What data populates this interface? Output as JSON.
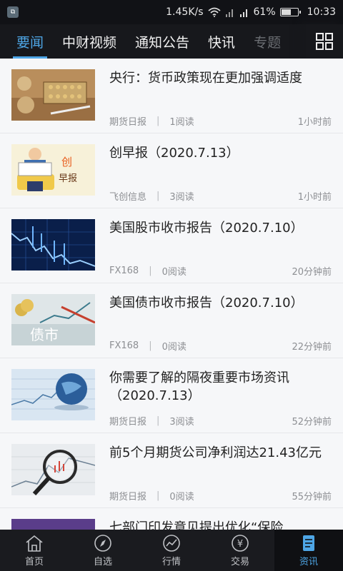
{
  "status_bar": {
    "app_icon_glyph": "⧉",
    "speed": "1.45K/s",
    "battery_pct": "61%",
    "battery_level": 0.61,
    "time": "10:33"
  },
  "tabs": [
    {
      "label": "要闻",
      "active": true
    },
    {
      "label": "中财视频"
    },
    {
      "label": "通知公告"
    },
    {
      "label": "快讯"
    },
    {
      "label": "专题"
    }
  ],
  "news": [
    {
      "title": "央行：货币政策现在更加强调适度",
      "source": "期货日报",
      "reads": "1阅读",
      "time": "1小时前"
    },
    {
      "title": "创早报（2020.7.13）",
      "source": "飞创信息",
      "reads": "3阅读",
      "time": "1小时前"
    },
    {
      "title": "美国股市收市报告（2020.7.10）",
      "source": "FX168",
      "reads": "0阅读",
      "time": "20分钟前"
    },
    {
      "title": "美国债市收市报告（2020.7.10）",
      "source": "FX168",
      "reads": "0阅读",
      "time": "22分钟前"
    },
    {
      "title": "你需要了解的隔夜重要市场资讯（2020.7.13）",
      "source": "期货日报",
      "reads": "3阅读",
      "time": "52分钟前"
    },
    {
      "title": "前5个月期货公司净利润达21.43亿元",
      "source": "期货日报",
      "reads": "0阅读",
      "time": "55分钟前"
    },
    {
      "title": "七部门印发意见提出优化“保险",
      "source": "",
      "reads": "",
      "time": ""
    }
  ],
  "thumbs": {
    "news1_label": "",
    "news2_label_1": "创",
    "news2_label_2": "早报",
    "news4_label": "债市"
  },
  "bottom_nav": [
    {
      "label": "首页",
      "icon": "home-icon"
    },
    {
      "label": "自选",
      "icon": "compass-icon"
    },
    {
      "label": "行情",
      "icon": "chart-icon"
    },
    {
      "label": "交易",
      "icon": "yen-icon"
    },
    {
      "label": "资讯",
      "icon": "document-icon",
      "active": true
    }
  ],
  "colors": {
    "accent": "#4ea6e6",
    "topbar": "#17181c",
    "background": "#f5f6f8"
  }
}
